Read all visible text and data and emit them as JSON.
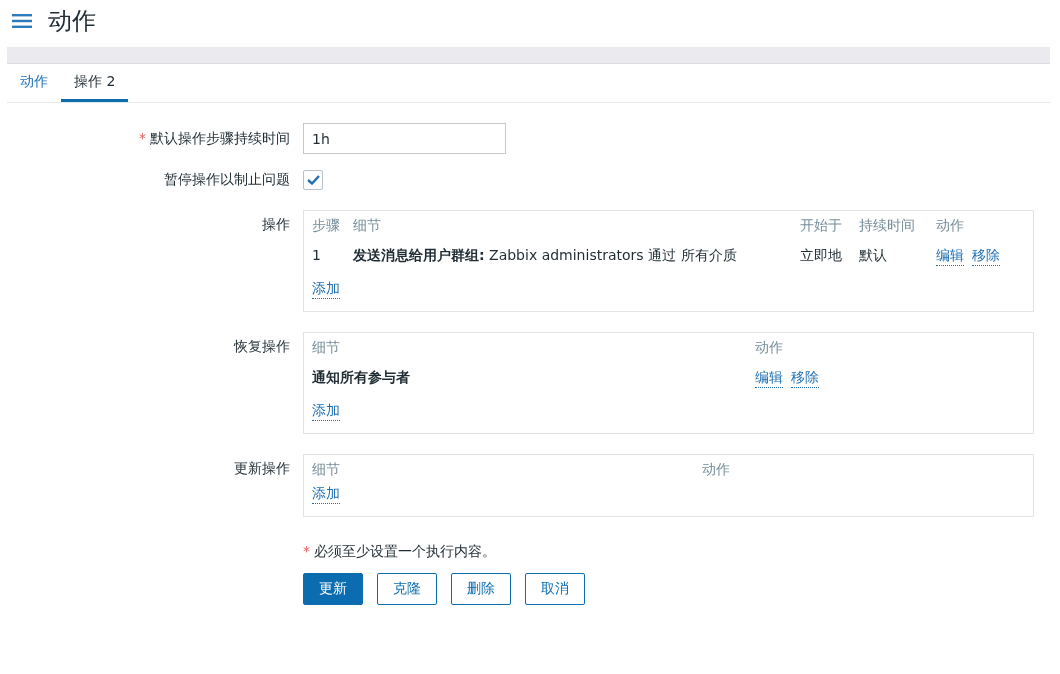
{
  "header": {
    "title": "动作"
  },
  "tabs": [
    {
      "label": "动作",
      "selected": false
    },
    {
      "label": "操作 2",
      "selected": true
    }
  ],
  "form": {
    "duration": {
      "required_mark": "*",
      "label": "默认操作步骤持续时间",
      "value": "1h"
    },
    "pause": {
      "label": "暂停操作以制止问题",
      "checked": true
    },
    "operations": {
      "label": "操作",
      "columns": [
        "步骤",
        "细节",
        "开始于",
        "持续时间",
        "动作"
      ],
      "rows": [
        {
          "step": "1",
          "details": "**发送消息给用户群组:** Zabbix administrators 通过 所有介质",
          "start": "立即地",
          "duration": "默认",
          "actions": [
            "编辑",
            "移除"
          ]
        }
      ],
      "add": "添加"
    },
    "recovery": {
      "label": "恢复操作",
      "columns": [
        "细节",
        "动作"
      ],
      "rows": [
        {
          "details": "通知所有参与者",
          "actions": [
            "编辑",
            "移除"
          ]
        }
      ],
      "add": "添加"
    },
    "update": {
      "label": "更新操作",
      "columns": [
        "细节",
        "动作"
      ],
      "add": "添加"
    },
    "footnote": {
      "mark": "*",
      "text": "必须至少设置一个执行内容。"
    },
    "buttons": [
      {
        "label": "更新",
        "kind": "primary"
      },
      {
        "label": "克隆",
        "kind": "secondary"
      },
      {
        "label": "删除",
        "kind": "secondary"
      },
      {
        "label": "取消",
        "kind": "secondary"
      }
    ]
  }
}
